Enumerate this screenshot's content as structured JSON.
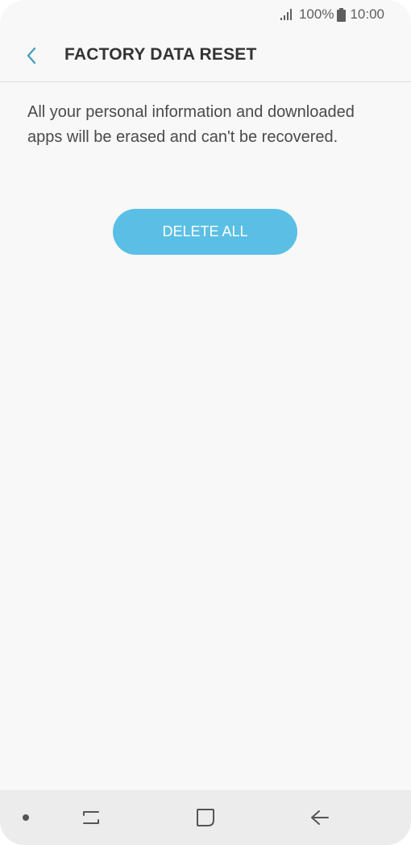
{
  "status_bar": {
    "battery_percent": "100%",
    "time": "10:00",
    "icons": [
      "signal-icon",
      "battery-icon"
    ]
  },
  "header": {
    "title": "FACTORY DATA RESET",
    "back_icon": "chevron-left-icon"
  },
  "content": {
    "description": "All your personal information and downloaded apps will be erased and can't be recovered.",
    "delete_button_label": "DELETE ALL"
  },
  "nav_bar": {
    "icons": [
      "dot-icon",
      "recent-apps-icon",
      "home-icon",
      "back-arrow-icon"
    ]
  },
  "colors": {
    "accent": "#5bbfe5",
    "back_chevron": "#4b9ec0",
    "background": "#f8f8f8",
    "nav_background": "#ececec"
  }
}
